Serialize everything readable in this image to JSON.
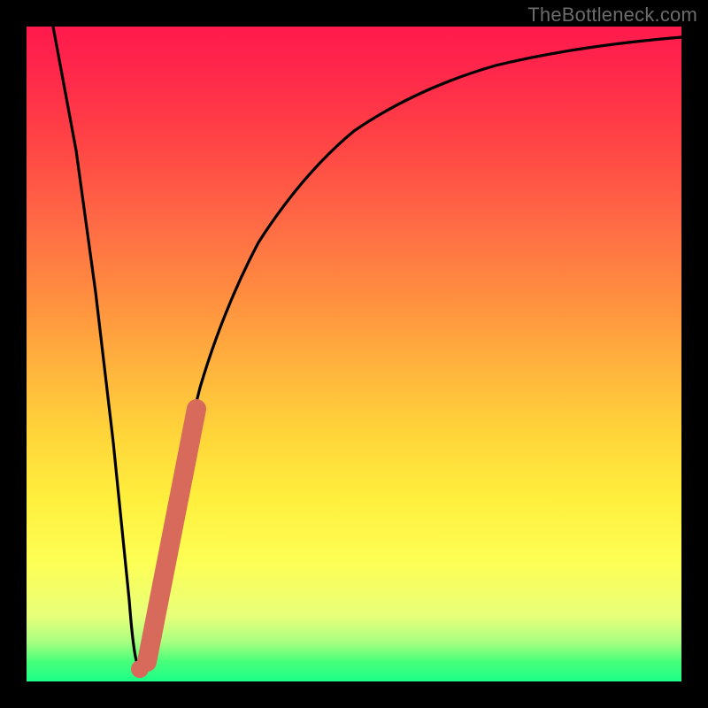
{
  "watermark": "TheBottleneck.com",
  "colors": {
    "frame": "#000000",
    "curve": "#000000",
    "marker": "#d86a5c"
  },
  "chart_data": {
    "type": "line",
    "title": "",
    "xlabel": "",
    "ylabel": "",
    "xlim": [
      0,
      100
    ],
    "ylim": [
      0,
      100
    ],
    "grid": false,
    "legend": false,
    "series": [
      {
        "name": "bottleneck-curve",
        "x": [
          0,
          3,
          6,
          9,
          11.5,
          12.5,
          13.5,
          15,
          18,
          21,
          25,
          30,
          36,
          43,
          52,
          63,
          78,
          100
        ],
        "y": [
          100,
          80,
          58,
          35,
          10,
          2,
          4,
          14,
          30,
          44,
          57,
          68,
          77,
          83,
          88,
          91.5,
          94,
          96
        ]
      }
    ],
    "annotations": [
      {
        "name": "highlight-segment",
        "type": "thick-line",
        "x": [
          12.5,
          20.5
        ],
        "y": [
          2,
          42
        ],
        "color": "#d86a5c"
      }
    ]
  }
}
